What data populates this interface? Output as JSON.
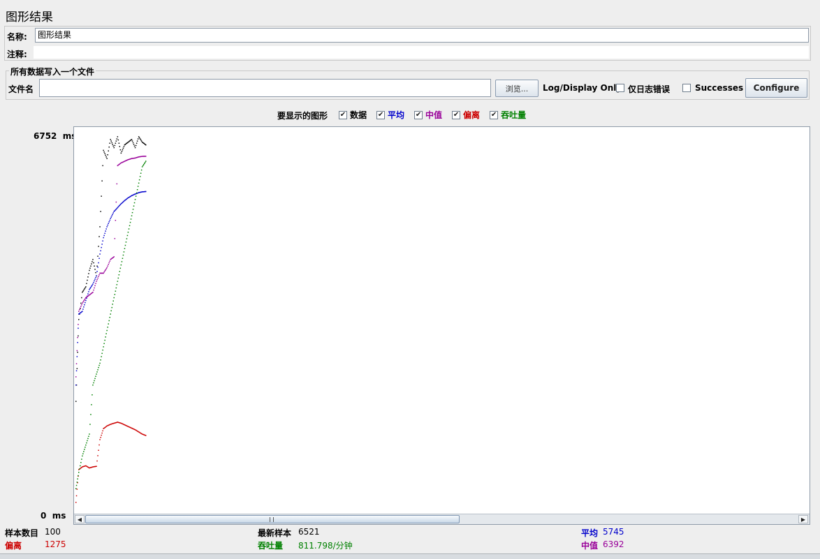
{
  "window": {
    "title": "图形结果"
  },
  "form": {
    "name_label": "名称:",
    "name_value": "图形结果",
    "comment_label": "注释:",
    "comment_value": ""
  },
  "file_section": {
    "legend": "所有数据写入一个文件",
    "filename_label": "文件名",
    "filename_value": "",
    "browse_label": "浏览...",
    "log_display_label": "Log/Display Only:",
    "errors_only_label": "仅日志错误",
    "errors_only_checked": false,
    "successes_label": "Successes",
    "successes_checked": false,
    "configure_label": "Configure"
  },
  "legend_bar": {
    "prompt": "要显示的图形",
    "items": [
      {
        "key": "data",
        "label": "数据",
        "checked": true,
        "color": "#000000"
      },
      {
        "key": "average",
        "label": "平均",
        "checked": true,
        "color": "#0000cc"
      },
      {
        "key": "median",
        "label": "中值",
        "checked": true,
        "color": "#990099"
      },
      {
        "key": "deviation",
        "label": "偏离",
        "checked": true,
        "color": "#cc0000"
      },
      {
        "key": "throughput",
        "label": "吞吐量",
        "checked": true,
        "color": "#008000"
      }
    ]
  },
  "chart_data": {
    "type": "scatter",
    "ylim": [
      0,
      6752
    ],
    "y_max_label": "6752  ms",
    "y_min_label": "0  ms",
    "x": [
      1,
      5,
      10,
      15,
      20,
      25,
      30,
      35,
      40,
      45,
      50,
      55,
      60,
      65,
      70,
      75,
      80,
      85,
      90,
      95,
      100
    ],
    "series": [
      {
        "name": "数据",
        "color": "#000000",
        "values": [
          1900,
          3400,
          3900,
          4000,
          4300,
          4500,
          4200,
          5100,
          6500,
          6350,
          6700,
          6550,
          6750,
          6450,
          6600,
          6650,
          6700,
          6550,
          6750,
          6650,
          6600
        ]
      },
      {
        "name": "平均",
        "color": "#0000cc",
        "values": [
          2200,
          3500,
          3550,
          3750,
          3950,
          4050,
          4200,
          4600,
          4900,
          5100,
          5250,
          5380,
          5450,
          5520,
          5580,
          5630,
          5670,
          5700,
          5725,
          5740,
          5745
        ]
      },
      {
        "name": "中值",
        "color": "#990099",
        "values": [
          2350,
          3550,
          3700,
          3800,
          3850,
          3900,
          4100,
          4250,
          4250,
          4350,
          4500,
          4550,
          6220,
          6270,
          6300,
          6330,
          6350,
          6360,
          6380,
          6390,
          6392
        ]
      },
      {
        "name": "偏离",
        "color": "#cc0000",
        "values": [
          50,
          650,
          700,
          720,
          680,
          700,
          710,
          1200,
          1400,
          1450,
          1480,
          1500,
          1520,
          1500,
          1470,
          1440,
          1410,
          1380,
          1340,
          1300,
          1275
        ]
      },
      {
        "name": "吞吐量",
        "color": "#008000",
        "values": [
          300,
          600,
          900,
          1100,
          1300,
          2200,
          2400,
          2600,
          2900,
          3200,
          3500,
          3800,
          4100,
          4400,
          4700,
          5000,
          5300,
          5600,
          5900,
          6200,
          6300
        ]
      }
    ]
  },
  "stats": {
    "samples_label": "样本数目",
    "samples_value": "100",
    "latest_label": "最新样本",
    "latest_value": "6521",
    "average_label": "平均",
    "average_value": "5745",
    "deviation_label": "偏离",
    "deviation_value": "1275",
    "throughput_label": "吞吐量",
    "throughput_value": "811.798/分钟",
    "median_label": "中值",
    "median_value": "6392"
  },
  "colors": {
    "average": "#0000cc",
    "median": "#990099",
    "deviation": "#cc0000",
    "throughput": "#008000"
  }
}
